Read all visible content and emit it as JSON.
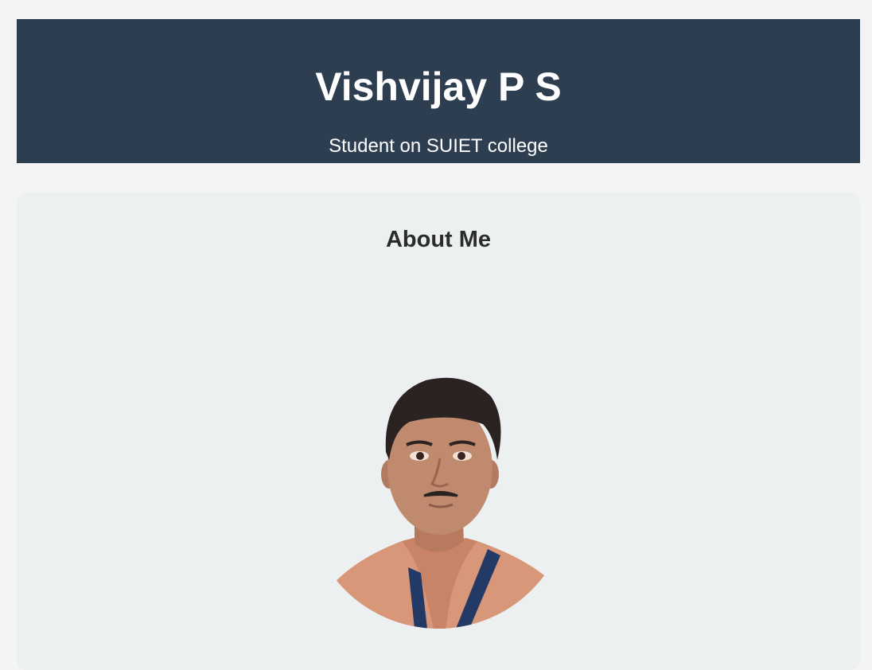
{
  "header": {
    "title": "Vishvijay P S",
    "subtitle": "Student on SUIET college"
  },
  "about": {
    "heading": "About Me",
    "photo_icon": "profile-photo"
  },
  "colors": {
    "page_background": "#f4f4f4",
    "header_background": "#2c3e50",
    "card_background": "#ecf0f1",
    "header_text": "#ffffff"
  }
}
